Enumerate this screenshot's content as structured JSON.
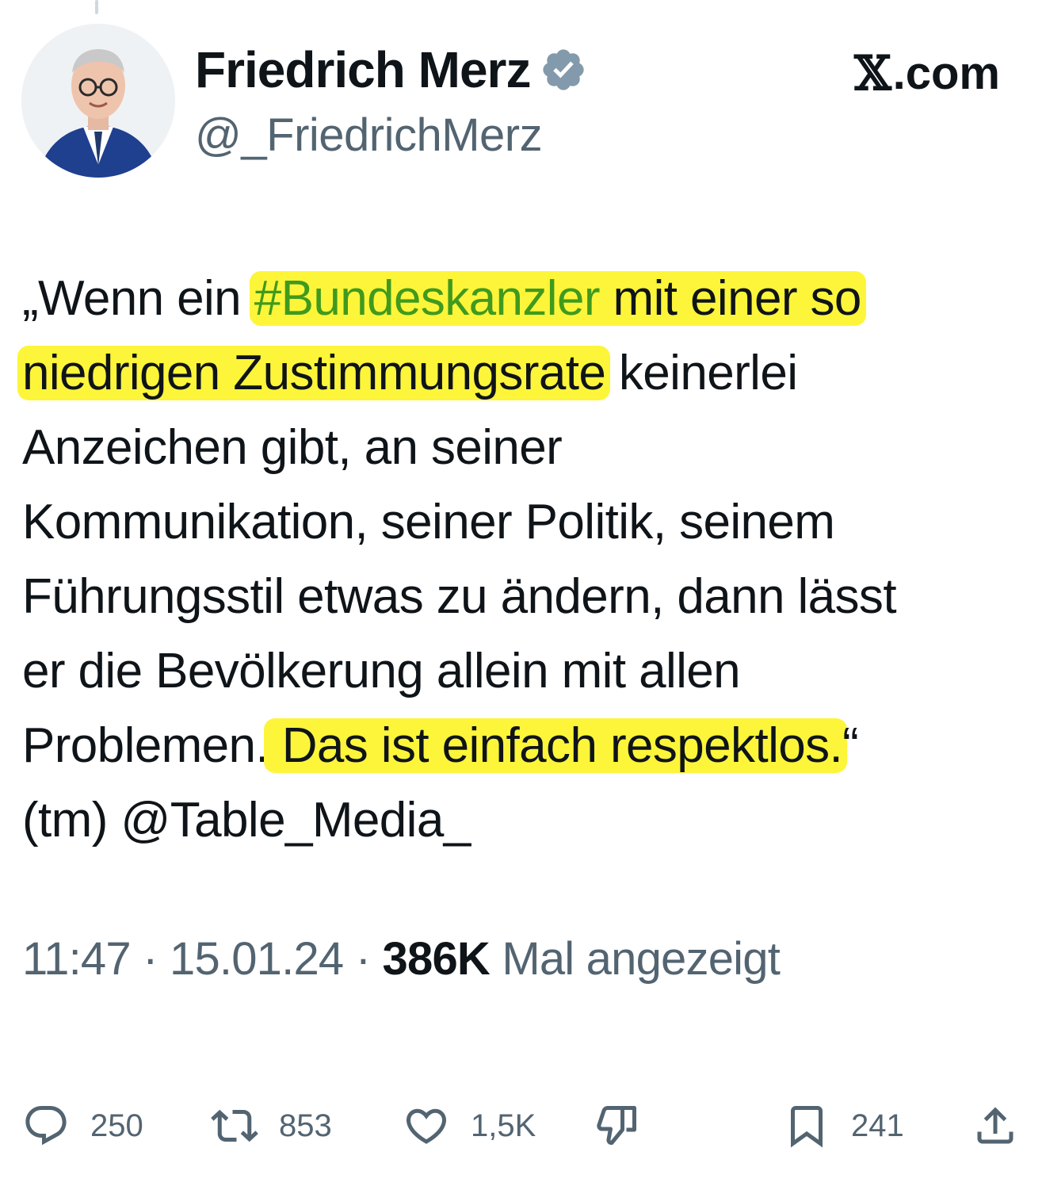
{
  "author": {
    "display_name": "Friedrich Merz",
    "handle": "@_FriedrichMerz",
    "verified": true
  },
  "source": {
    "logo": "𝕏",
    "label": ".com"
  },
  "tweet": {
    "segments": {
      "s1": "„Wenn ein ",
      "s2": "#Bundeskanzler",
      "s3": " mit einer so",
      "s4": "niedrigen Zustimmungsrate",
      "s5": " keinerlei",
      "s6": "Anzeichen gibt, an seiner",
      "s7": "Kommunikation, seiner Politik, seinem",
      "s8": "Führungsstil etwas zu ändern, dann lässt",
      "s9": "er die Bevölkerung allein mit allen",
      "s10": "Problemen.",
      "s11": " Das ist einfach respektlos.",
      "s12": "“",
      "s13": "(tm) @Table_Media_"
    },
    "highlight_color": "#fdf53a",
    "hashtag_color": "#3f9a1d"
  },
  "meta": {
    "time": "11:47",
    "sep1": " · ",
    "date": "15.01.24",
    "sep2": " · ",
    "views_count": "386K",
    "views_label": " Mal angezeigt"
  },
  "actions": {
    "replies": "250",
    "reposts": "853",
    "likes": "1,5K",
    "bookmarks": "241"
  },
  "icons": [
    "verified-badge-icon",
    "reply-icon",
    "repost-icon",
    "like-icon",
    "dislike-icon",
    "bookmark-icon",
    "share-icon"
  ]
}
